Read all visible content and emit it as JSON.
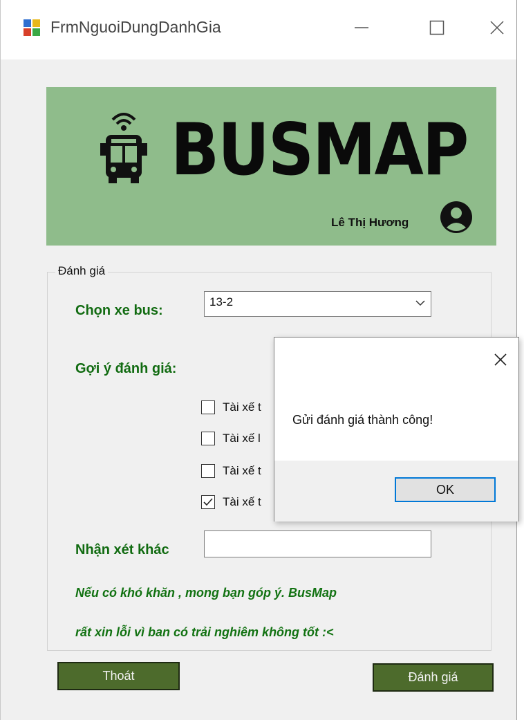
{
  "window": {
    "title": "FrmNguoiDungDanhGia"
  },
  "banner": {
    "brand": "BUSMAP",
    "user_name": "Lê Thị Hương",
    "background": "#8fbc8b"
  },
  "form": {
    "group_title": "Đánh giá",
    "choose_bus_label": "Chọn xe bus:",
    "bus_selected": "13-2",
    "suggest_label": "Gợi ý đánh giá:",
    "suggestions": [
      {
        "label": "Tài xế t",
        "checked": false
      },
      {
        "label": "Tài xế l",
        "checked": false
      },
      {
        "label": "Tài xế t",
        "checked": false
      },
      {
        "label": "Tài xế t",
        "checked": true
      }
    ],
    "other_comment_label": "Nhận xét khác",
    "other_comment_value": "",
    "note_line1": "Nếu có khó khăn , mong bạn góp ý. BusMap",
    "note_line2": "rất xin lỗi vì ban có trải nghiêm không tốt :<",
    "exit_button": "Thoát",
    "submit_button": "Đánh giá"
  },
  "dialog": {
    "message": "Gửi đánh giá thành công!",
    "ok_button": "OK"
  },
  "colors": {
    "label_green": "#116b11",
    "button_dark_green": "#4d6b2c",
    "focus_blue": "#0078d7"
  }
}
